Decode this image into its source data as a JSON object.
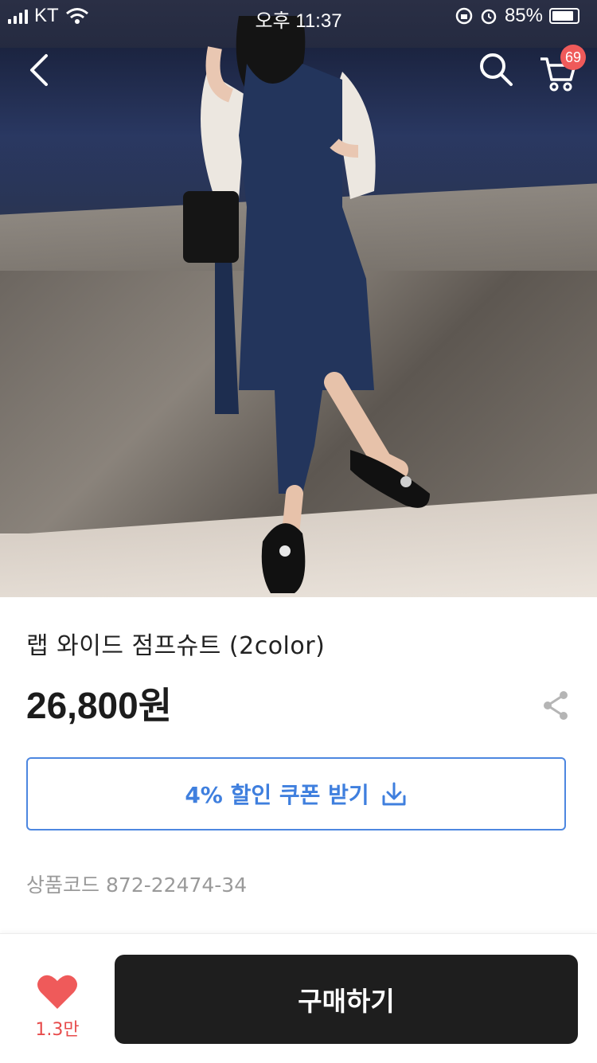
{
  "status_bar": {
    "carrier": "KT",
    "time": "오후 11:37",
    "battery": "85%"
  },
  "nav": {
    "cart_count": "69"
  },
  "product": {
    "name": "랩 와이드 점프슈트 (2color)",
    "price": "26,800원",
    "coupon_label": "4% 할인 쿠폰 받기",
    "code_label": "상품코드",
    "code_value": "872-22474-34"
  },
  "bottom_bar": {
    "like_count": "1.3만",
    "buy_label": "구매하기"
  },
  "colors": {
    "accent_blue": "#3f7fde",
    "heart_red": "#ef5a5a",
    "buy_button": "#1e1e1e"
  },
  "icons": [
    "back-arrow-icon",
    "search-icon",
    "cart-icon",
    "share-icon",
    "download-icon",
    "heart-icon"
  ]
}
